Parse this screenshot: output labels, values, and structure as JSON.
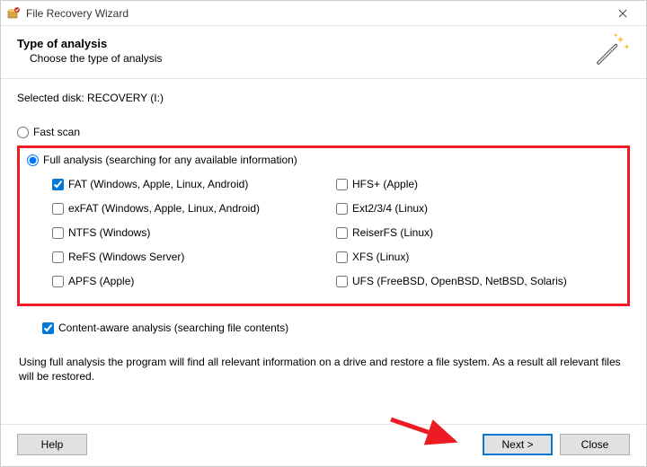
{
  "window": {
    "title": "File Recovery Wizard"
  },
  "header": {
    "title": "Type of analysis",
    "subtitle": "Choose the type of analysis"
  },
  "selected_disk_label": "Selected disk: RECOVERY (I:)",
  "options": {
    "fast_scan": {
      "label": "Fast scan",
      "selected": false
    },
    "full_analysis": {
      "label": "Full analysis (searching for any available information)",
      "selected": true
    }
  },
  "filesystems_left": [
    {
      "label": "FAT (Windows, Apple, Linux, Android)",
      "checked": true
    },
    {
      "label": "exFAT (Windows, Apple, Linux, Android)",
      "checked": false
    },
    {
      "label": "NTFS (Windows)",
      "checked": false
    },
    {
      "label": "ReFS (Windows Server)",
      "checked": false
    },
    {
      "label": "APFS (Apple)",
      "checked": false
    }
  ],
  "filesystems_right": [
    {
      "label": "HFS+ (Apple)",
      "checked": false
    },
    {
      "label": "Ext2/3/4 (Linux)",
      "checked": false
    },
    {
      "label": "ReiserFS (Linux)",
      "checked": false
    },
    {
      "label": "XFS (Linux)",
      "checked": false
    },
    {
      "label": "UFS (FreeBSD, OpenBSD, NetBSD, Solaris)",
      "checked": false
    }
  ],
  "content_aware": {
    "label": "Content-aware analysis (searching file contents)",
    "checked": true
  },
  "info_text": "Using full analysis the program will find all relevant information on a drive and restore a file system. As a result all relevant files will be restored.",
  "buttons": {
    "help": "Help",
    "next": "Next >",
    "close": "Close"
  }
}
